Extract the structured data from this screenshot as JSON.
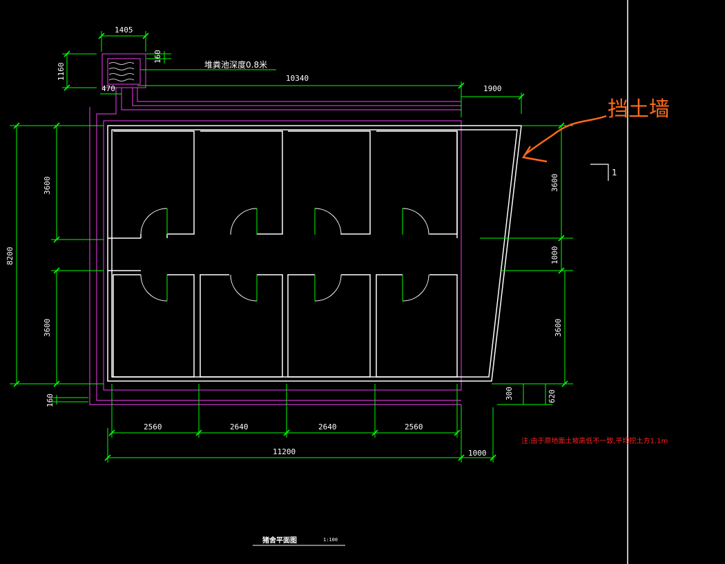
{
  "colors": {
    "background": "#000000",
    "wall": "#ffffff",
    "dimension": "#00ff00",
    "pool": "#cc33cc",
    "note": "#ff2020",
    "callout": "#ff6a1a"
  },
  "callout": {
    "label": "挡土墙"
  },
  "pool": {
    "depth_label": "堆粪池深度0.8米"
  },
  "section_marker": {
    "label": "1"
  },
  "dimensions": {
    "pool_width": "1405",
    "pool_height": "1160",
    "pool_wall": "160",
    "pool_offset": "470",
    "top_length": "10340",
    "top_right": "1900",
    "overall_height": "8200",
    "left_upper": "3600",
    "left_lower": "3600",
    "left_bottom_wall": "160",
    "right_upper": "3600",
    "right_aisle": "1000",
    "right_lower": "3600",
    "right_small_1": "300",
    "right_small_2": "620",
    "bay_1": "2560",
    "bay_2": "2640",
    "bay_3": "2640",
    "bay_4": "2560",
    "overall_length": "11200",
    "bottom_right": "1000"
  },
  "note": "注:由于原地面土坡高低不一致,平均挖土方1.1m",
  "title": {
    "name": "猪舍平面图",
    "scale": "1:100"
  }
}
